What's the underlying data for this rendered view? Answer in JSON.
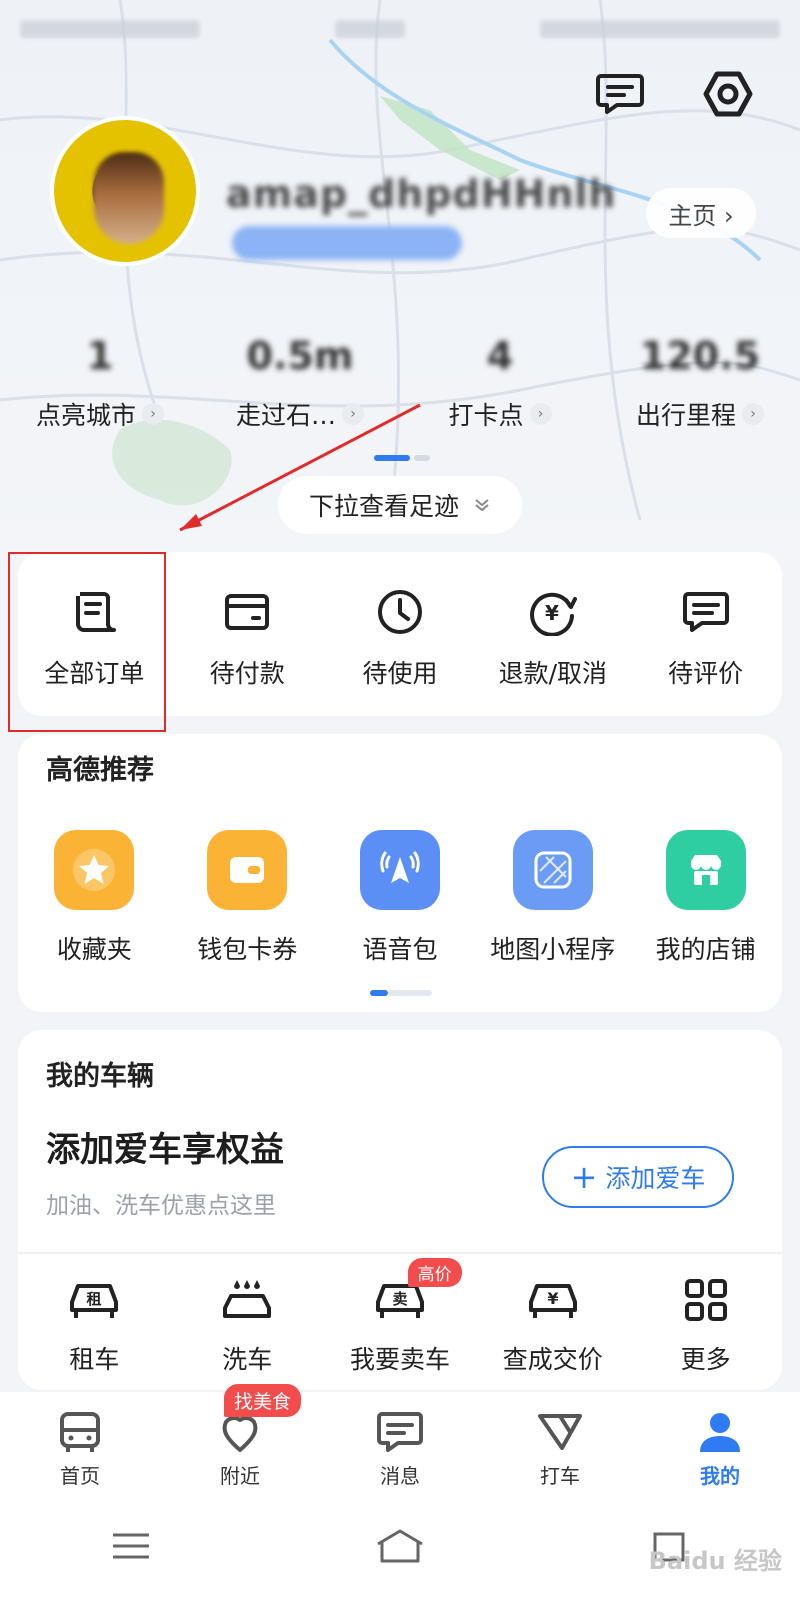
{
  "header": {
    "home_label": "主页 ›",
    "stats": [
      {
        "label": "点亮城市"
      },
      {
        "label": "走过石…"
      },
      {
        "label": "打卡点"
      },
      {
        "label": "出行里程"
      }
    ],
    "pull_label": "下拉查看足迹"
  },
  "orders": [
    {
      "label": "全部订单",
      "icon": "order-list-icon"
    },
    {
      "label": "待付款",
      "icon": "wallet-icon"
    },
    {
      "label": "待使用",
      "icon": "clock-icon"
    },
    {
      "label": "退款/取消",
      "icon": "refund-icon"
    },
    {
      "label": "待评价",
      "icon": "comment-icon"
    }
  ],
  "recommend": {
    "title": "高德推荐",
    "items": [
      {
        "label": "收藏夹",
        "icon": "star-icon",
        "color": "#fbb335"
      },
      {
        "label": "钱包卡券",
        "icon": "wallet-card-icon",
        "color": "#fbb335"
      },
      {
        "label": "语音包",
        "icon": "voice-pack-icon",
        "color": "#5b8ff5"
      },
      {
        "label": "地图小程序",
        "icon": "mini-program-icon",
        "color": "#6b9cf5"
      },
      {
        "label": "我的店铺",
        "icon": "shop-icon",
        "color": "#2fcea2"
      }
    ]
  },
  "vehicle": {
    "title": "我的车辆",
    "headline": "添加爱车享权益",
    "subtitle": "加油、洗车优惠点这里",
    "add_button": "添加爱车",
    "services": [
      {
        "label": "租车",
        "icon": "car-rent-icon",
        "glyph": "租"
      },
      {
        "label": "洗车",
        "icon": "car-wash-icon"
      },
      {
        "label": "我要卖车",
        "icon": "car-sell-icon",
        "glyph": "卖",
        "badge": "高价"
      },
      {
        "label": "查成交价",
        "icon": "car-price-icon",
        "glyph": "¥"
      },
      {
        "label": "更多",
        "icon": "grid-more-icon"
      }
    ]
  },
  "tabbar": {
    "items": [
      {
        "label": "首页",
        "icon": "bus-home-icon"
      },
      {
        "label": "附近",
        "icon": "nearby-icon",
        "badge": "找美食"
      },
      {
        "label": "消息",
        "icon": "message-icon"
      },
      {
        "label": "打车",
        "icon": "taxi-icon"
      },
      {
        "label": "我的",
        "icon": "profile-icon",
        "active": true
      }
    ]
  },
  "watermark": "Baidu 经验",
  "colors": {
    "accent": "#2f7bf3",
    "highlight": "#e02b2b",
    "badge": "#f24c4c"
  }
}
